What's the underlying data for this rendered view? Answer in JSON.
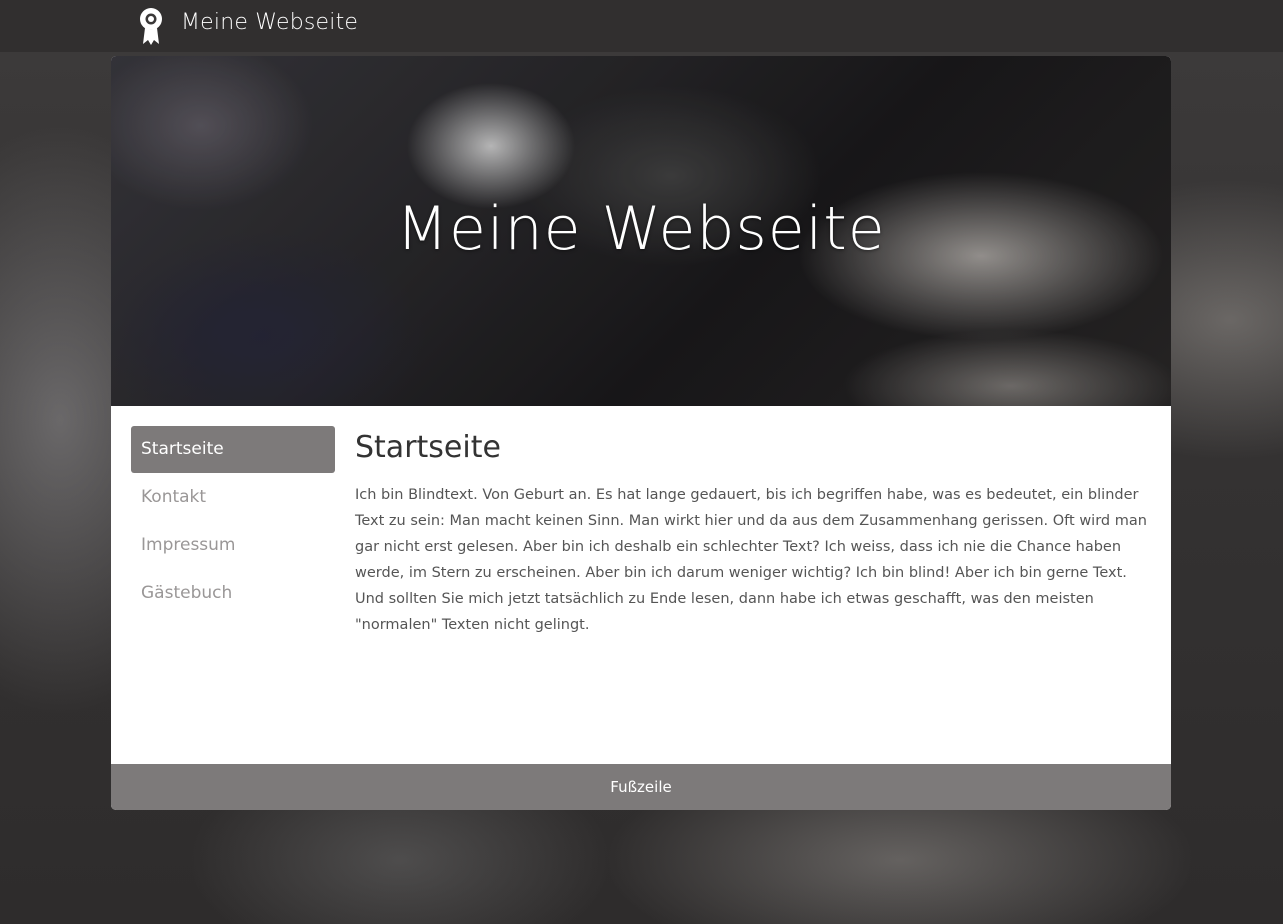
{
  "header": {
    "site_name": "Meine Webseite",
    "logo_icon": "award-ribbon-icon"
  },
  "hero": {
    "title": "Meine Webseite"
  },
  "sidebar": {
    "items": [
      {
        "label": "Startseite",
        "active": true
      },
      {
        "label": "Kontakt",
        "active": false
      },
      {
        "label": "Impressum",
        "active": false
      },
      {
        "label": "Gästebuch",
        "active": false
      }
    ]
  },
  "main": {
    "title": "Startseite",
    "text": "Ich bin Blindtext. Von Geburt an. Es hat lange gedauert, bis ich begriffen habe, was es bedeutet, ein blinder Text zu sein: Man macht keinen Sinn. Man wirkt hier und da aus dem Zusammenhang gerissen. Oft wird man gar nicht erst gelesen. Aber bin ich deshalb ein schlechter Text? Ich weiss, dass ich nie die Chance haben werde, im Stern zu erscheinen. Aber bin ich darum weniger wichtig? Ich bin blind! Aber ich bin gerne Text. Und sollten Sie mich jetzt tatsächlich zu Ende lesen, dann habe ich etwas geschafft, was den meisten \"normalen\" Texten nicht gelingt."
  },
  "footer": {
    "text": "Fußzeile"
  },
  "colors": {
    "nav_active_bg": "#7d7a7a",
    "footer_bg": "#7d7a7a",
    "text": "#555555"
  }
}
